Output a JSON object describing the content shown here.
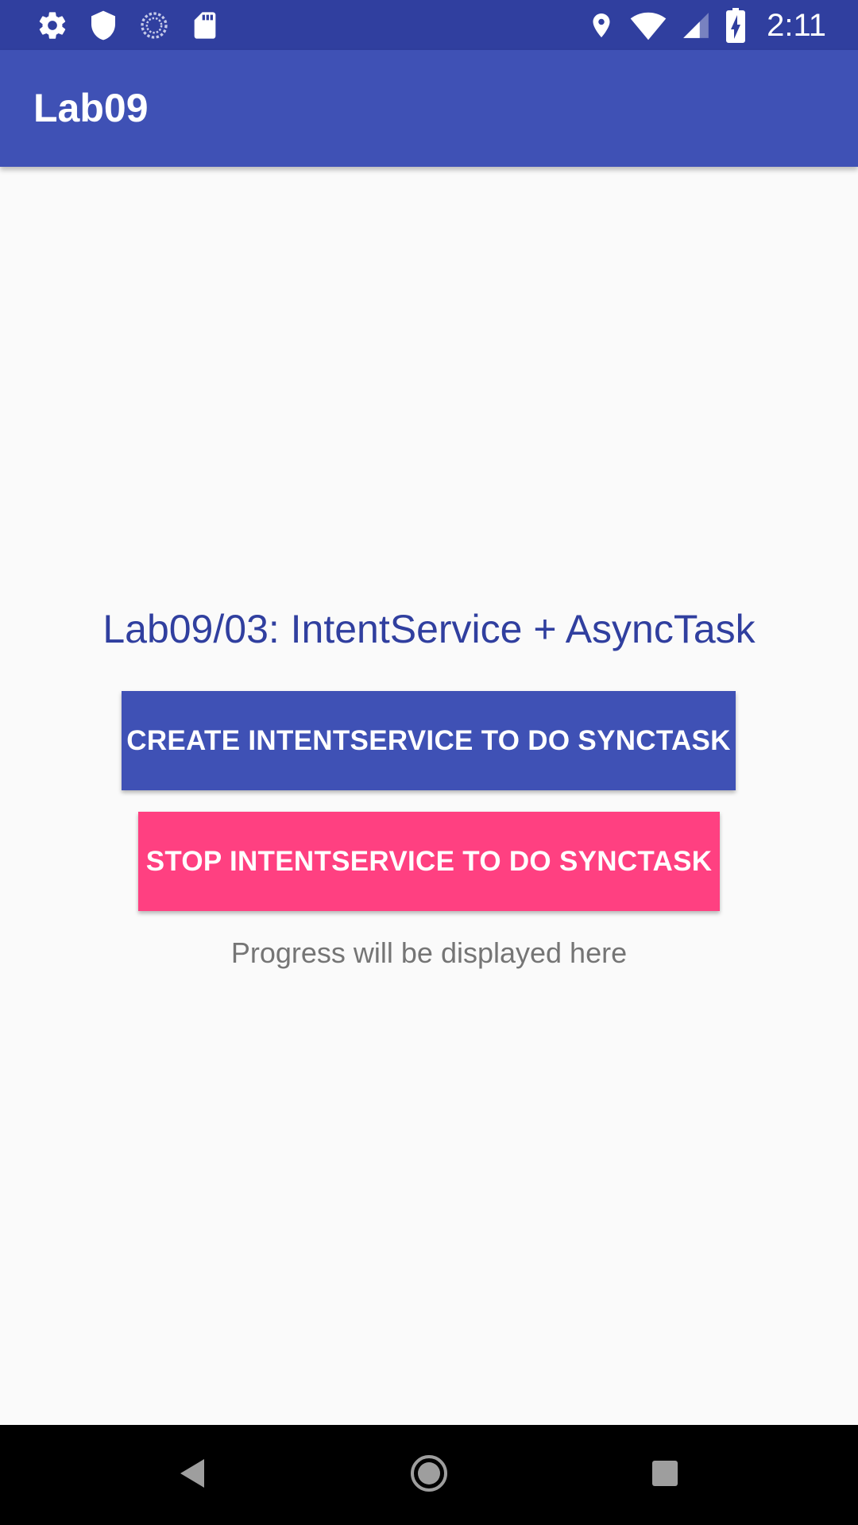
{
  "status_bar": {
    "time": "2:11",
    "left_icons": [
      "gear-icon",
      "shield-icon",
      "sync-icon",
      "sd-card-icon"
    ],
    "right_icons": [
      "location-icon",
      "wifi-icon",
      "cell-signal-icon",
      "battery-charging-icon"
    ]
  },
  "app_bar": {
    "title": "Lab09"
  },
  "main": {
    "heading": "Lab09/03: IntentService + AsyncTask",
    "create_button_label": "CREATE INTENTSERVICE TO DO SYNCTASK",
    "stop_button_label": "STOP INTENTSERVICE TO DO SYNCTASK",
    "progress_text": "Progress will be displayed here"
  },
  "nav_bar": {
    "icons": [
      "back-icon",
      "home-icon",
      "recents-icon"
    ]
  },
  "colors": {
    "status_bar": "#303f9f",
    "primary": "#3f51b5",
    "accent": "#ff4081",
    "heading_text": "#303f9f",
    "secondary_text": "#757575",
    "background": "#fafafa"
  }
}
